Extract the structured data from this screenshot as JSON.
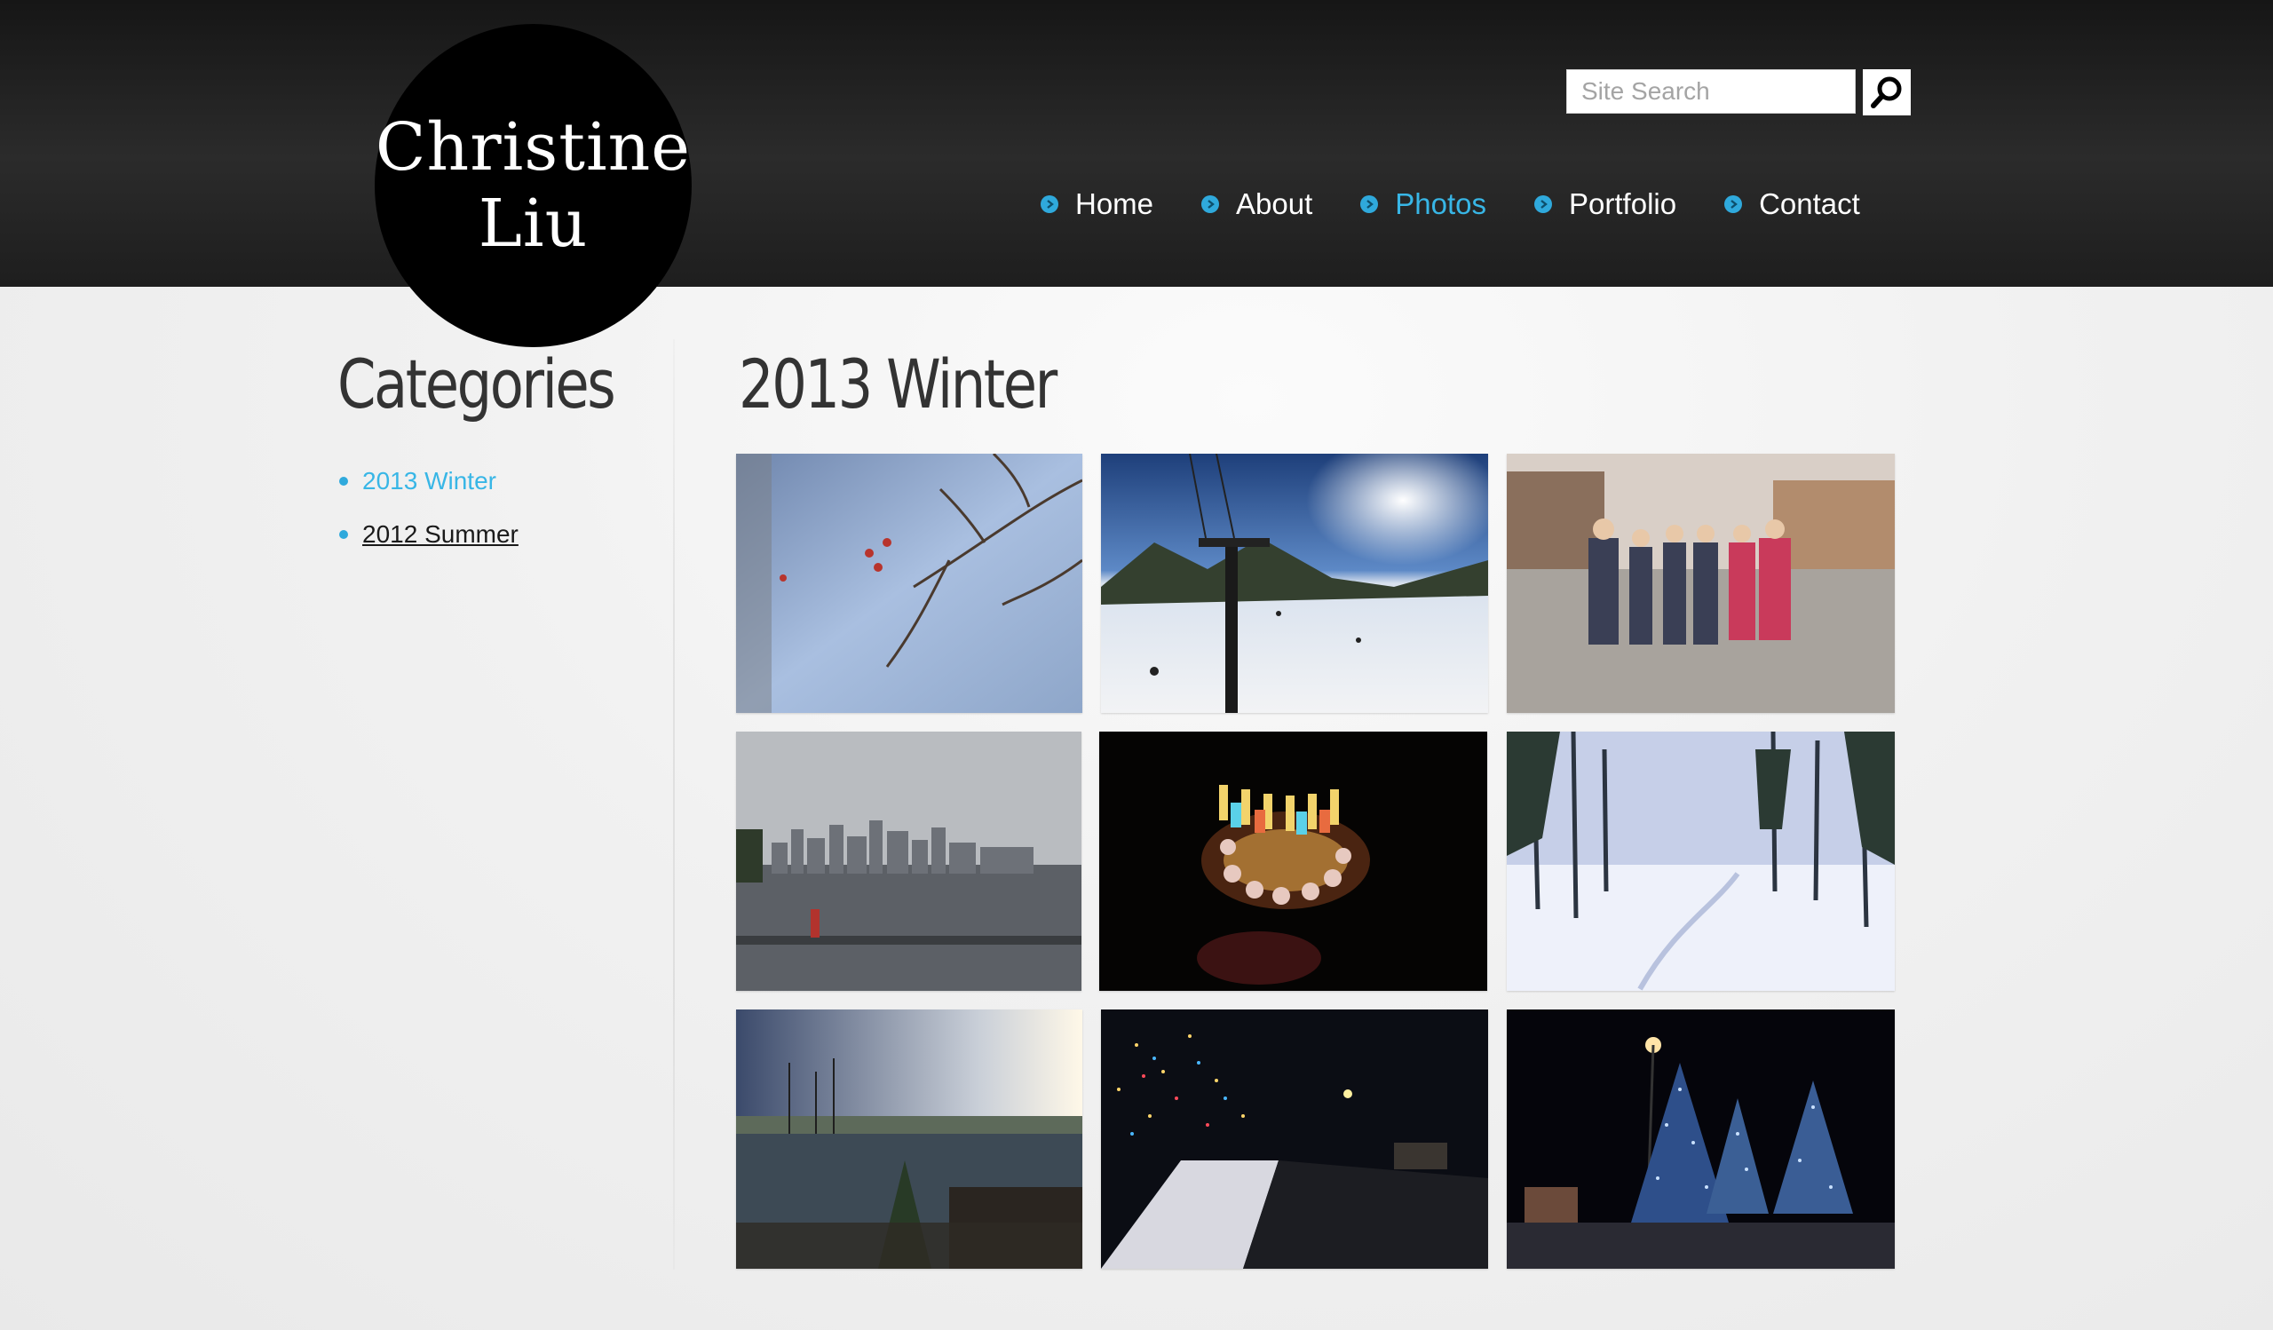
{
  "site": {
    "logo_line1": "Christine",
    "logo_line2": "Liu"
  },
  "search": {
    "placeholder": "Site Search"
  },
  "nav": {
    "items": [
      {
        "label": "Home",
        "active": false
      },
      {
        "label": "About",
        "active": false
      },
      {
        "label": "Photos",
        "active": true
      },
      {
        "label": "Portfolio",
        "active": false
      },
      {
        "label": "Contact",
        "active": false
      }
    ]
  },
  "sidebar": {
    "title": "Categories",
    "categories": [
      {
        "label": "2013 Winter",
        "active": true
      },
      {
        "label": "2012 Summer",
        "active": false
      }
    ]
  },
  "main": {
    "title": "2013 Winter"
  },
  "colors": {
    "accent": "#38b6e6",
    "header_bg": "#222222",
    "text_dark": "#333333"
  },
  "icons": {
    "search": "magnifier-icon",
    "nav_bullet": "arrow-circle-icon"
  }
}
